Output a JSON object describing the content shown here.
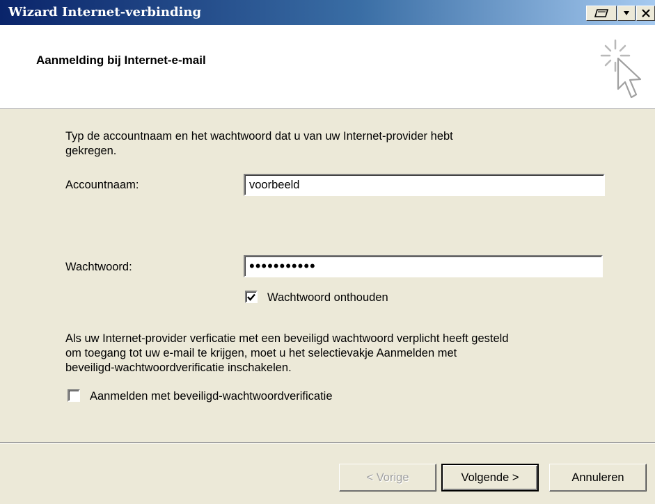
{
  "window": {
    "title": "Wizard Internet-verbinding"
  },
  "header": {
    "heading": "Aanmelding bij Internet-e-mail",
    "icon": "wizard-cursor-sparkle-icon"
  },
  "form": {
    "intro_line1": "Typ de accountnaam en het wachtwoord dat u van uw Internet-provider hebt",
    "intro_line2": "gekregen.",
    "account_label": "Accountnaam:",
    "account_value": "voorbeeld",
    "password_label": "Wachtwoord:",
    "password_value": "voorbeeld1x",
    "remember_label": "Wachtwoord onthouden",
    "remember_checked": true,
    "spa_line1": "Als uw Internet-provider verficatie met een beveiligd wachtwoord verplicht heeft gesteld",
    "spa_line2": "om toegang tot uw e-mail te krijgen, moet u het selectievakje Aanmelden met",
    "spa_line3": "beveiligd-wachtwoordverificatie inschakelen.",
    "spa_label": "Aanmelden met beveiligd-wachtwoordverificatie",
    "spa_checked": false
  },
  "buttons": {
    "back": "< Vorige",
    "next": "Volgende >",
    "cancel": "Annuleren"
  }
}
